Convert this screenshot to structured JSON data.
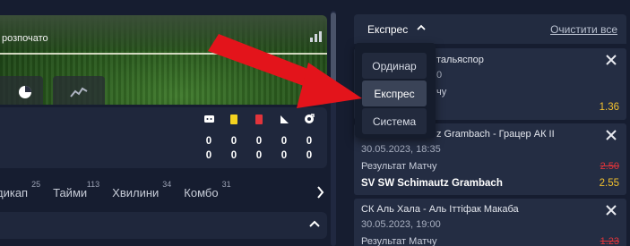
{
  "video": {
    "status_text": "розпочато"
  },
  "scoreboard": {
    "rows": [
      [
        "0",
        "0",
        "0",
        "0",
        "0"
      ],
      [
        "0",
        "0",
        "0",
        "0",
        "0"
      ]
    ],
    "icons": [
      "corner-card-icon",
      "yellow-card-icon",
      "red-card-icon",
      "corner-flag-icon",
      "penalty-icon"
    ],
    "colors": {
      "yellow_card": "#f4d21f",
      "red_card": "#e2343b"
    }
  },
  "tabs": [
    {
      "label": "дикап",
      "count": "25"
    },
    {
      "label": "Тайми",
      "count": "113"
    },
    {
      "label": "Хвилини",
      "count": "34"
    },
    {
      "label": "Комбо",
      "count": "31"
    }
  ],
  "betslip": {
    "title": "Експрес",
    "clear_label": "Очистити все",
    "dropdown": {
      "options": [
        "Ординар",
        "Експрес",
        "Система"
      ],
      "selected": "Експрес"
    },
    "cards": [
      {
        "event": "тальяспор",
        "datetime": "0",
        "market": "чу",
        "selection": "",
        "odds_old": "",
        "odds": "1.36"
      },
      {
        "event": "z Grambach - Грацер АК II",
        "datetime": "30.05.2023, 18:35",
        "market": "Результат Матчу",
        "selection": "SV SW Schimautz Grambach",
        "odds_old": "2.50",
        "odds": "2.55"
      },
      {
        "event": "СК Аль Хала - Аль Іттіфак Макаба",
        "datetime": "30.05.2023, 19:00",
        "market": "Результат Матчу",
        "selection": "",
        "odds_old": "1.23",
        "odds": ""
      }
    ]
  },
  "colors": {
    "background": "#161d30",
    "panel": "#242d43",
    "odds": "#f2c12e",
    "odds_old": "#e0343a",
    "annotation_arrow": "#e3141b"
  }
}
